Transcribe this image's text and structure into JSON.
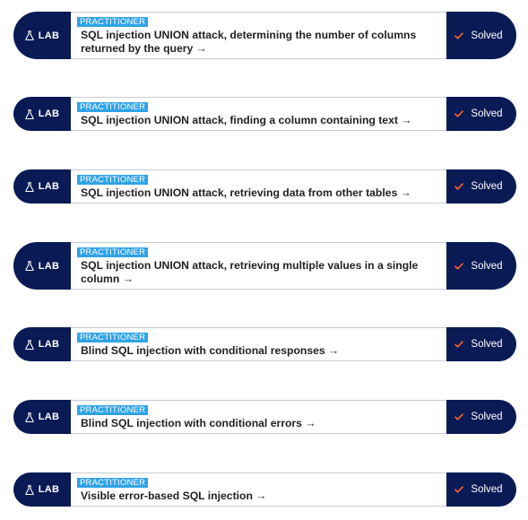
{
  "colors": {
    "navy": "#0a1a55",
    "badge": "#2fa3e6",
    "check": "#ff6633"
  },
  "labs": [
    {
      "tag": "LAB",
      "tag_icon": "flask-icon",
      "level": "PRACTITIONER",
      "title": "SQL injection UNION attack, determining the number of columns returned by the query →",
      "status": "Solved",
      "status_icon": "check-icon"
    },
    {
      "tag": "LAB",
      "tag_icon": "flask-icon",
      "level": "PRACTITIONER",
      "title": "SQL injection UNION attack, finding a column containing text →",
      "status": "Solved",
      "status_icon": "check-icon"
    },
    {
      "tag": "LAB",
      "tag_icon": "flask-icon",
      "level": "PRACTITIONER",
      "title": "SQL injection UNION attack, retrieving data from other tables →",
      "status": "Solved",
      "status_icon": "check-icon"
    },
    {
      "tag": "LAB",
      "tag_icon": "flask-icon",
      "level": "PRACTITIONER",
      "title": "SQL injection UNION attack, retrieving multiple values in a single column →",
      "status": "Solved",
      "status_icon": "check-icon"
    },
    {
      "tag": "LAB",
      "tag_icon": "flask-icon",
      "level": "PRACTITIONER",
      "title": "Blind SQL injection with conditional responses →",
      "status": "Solved",
      "status_icon": "check-icon"
    },
    {
      "tag": "LAB",
      "tag_icon": "flask-icon",
      "level": "PRACTITIONER",
      "title": "Blind SQL injection with conditional errors →",
      "status": "Solved",
      "status_icon": "check-icon"
    },
    {
      "tag": "LAB",
      "tag_icon": "flask-icon",
      "level": "PRACTITIONER",
      "title": "Visible error-based SQL injection →",
      "status": "Solved",
      "status_icon": "check-icon"
    }
  ]
}
